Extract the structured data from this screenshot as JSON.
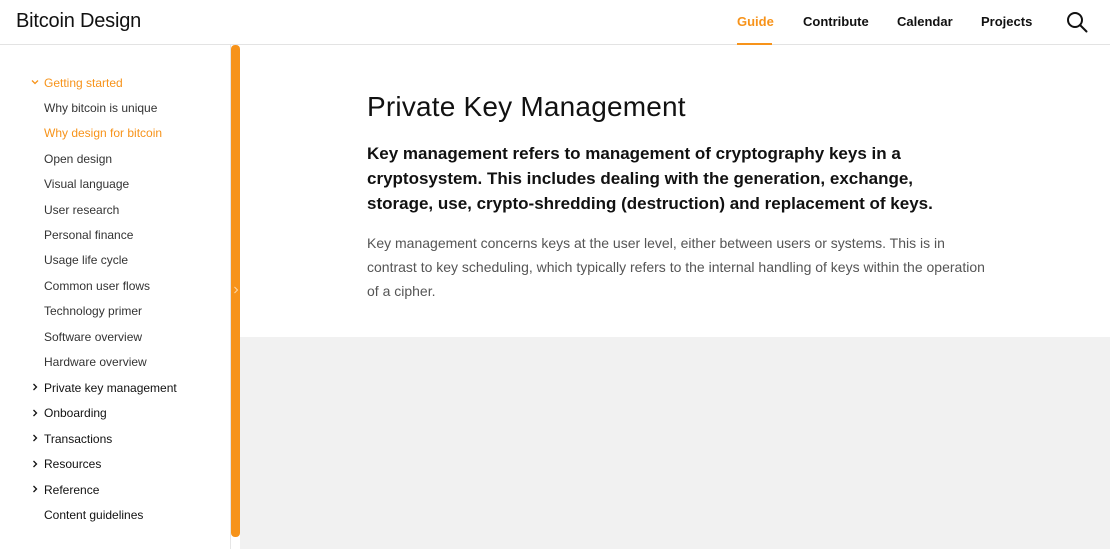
{
  "header": {
    "brand": "Bitcoin Design",
    "nav": [
      {
        "label": "Guide",
        "active": true
      },
      {
        "label": "Contribute",
        "active": false
      },
      {
        "label": "Calendar",
        "active": false
      },
      {
        "label": "Projects",
        "active": false
      }
    ],
    "search_icon": "search-icon"
  },
  "sidebar": {
    "section": {
      "label": "Getting started",
      "expanded": true
    },
    "children": [
      {
        "label": "Why bitcoin is unique",
        "active": false
      },
      {
        "label": "Why design for bitcoin",
        "active": true
      },
      {
        "label": "Open design",
        "active": false
      },
      {
        "label": "Visual language",
        "active": false
      },
      {
        "label": "User research",
        "active": false
      },
      {
        "label": "Personal finance",
        "active": false
      },
      {
        "label": "Usage life cycle",
        "active": false
      },
      {
        "label": "Common user flows",
        "active": false
      },
      {
        "label": "Technology primer",
        "active": false
      },
      {
        "label": "Software overview",
        "active": false
      },
      {
        "label": "Hardware overview",
        "active": false
      }
    ],
    "sections": [
      {
        "label": "Private key management",
        "expandable": true
      },
      {
        "label": "Onboarding",
        "expandable": true
      },
      {
        "label": "Transactions",
        "expandable": true
      },
      {
        "label": "Resources",
        "expandable": true
      },
      {
        "label": "Reference",
        "expandable": true
      },
      {
        "label": "Content guidelines",
        "expandable": false
      }
    ]
  },
  "main": {
    "title": "Private Key Management",
    "lead": "Key management refers to management of cryptography keys in a cryptosystem. This includes dealing with the generation, exchange, storage, use, crypto-shredding (destruction) and replacement of keys.",
    "body": "Key management concerns keys at the user level, either between users or systems. This is in contrast to key scheduling, which typically refers to the internal handling of keys within the operation of a cipher."
  },
  "colors": {
    "accent": "#f7931a",
    "text": "#111111",
    "muted": "#555555",
    "gray_area": "#f1f1f1"
  }
}
